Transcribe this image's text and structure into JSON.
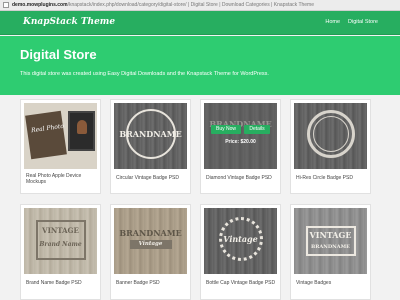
{
  "browser": {
    "url_host": "demo.mowplugins.com",
    "url_path": "/knapstack/index.php/download/category/digital-store/ | Digital Store | Download Categories | Knapstack Theme"
  },
  "site": {
    "title": "KnapStack Theme",
    "nav": [
      "Home",
      "Digital Store"
    ]
  },
  "hero": {
    "title": "Digital Store",
    "description": "This digital store was created using Easy Digital Downloads and the Knapstack Theme for WordPress."
  },
  "products": [
    {
      "caption": "Real Photo Apple Device Mockups",
      "image_text": "Real Photo"
    },
    {
      "caption": "Circular Vintage Badge PSD",
      "image_text": "BRANDNAME"
    },
    {
      "caption": "Diamond Vintage Badge PSD",
      "image_text": "BRANDNAME",
      "buy_label": "Buy Now",
      "details_label": "Details",
      "price": "Price: $20.00"
    },
    {
      "caption": "Hi-Res Circle Badge PSD",
      "image_text": ""
    },
    {
      "caption": "Brand Name Badge PSD",
      "image_text": "VINTAGE",
      "image_text_2": "Brand Name"
    },
    {
      "caption": "Banner Badge PSD",
      "image_text": "BRANDNAME",
      "image_text_2": "Vintage"
    },
    {
      "caption": "Bottle Cap Vintage Badge PSD",
      "image_text": "Vintage"
    },
    {
      "caption": "Vintage Badges",
      "image_text": "VINTAGE",
      "image_text_2": "BRANDNAME"
    }
  ],
  "colors": {
    "header": "#27ae60",
    "hero": "#2ecc71",
    "button": "#27ae60"
  }
}
